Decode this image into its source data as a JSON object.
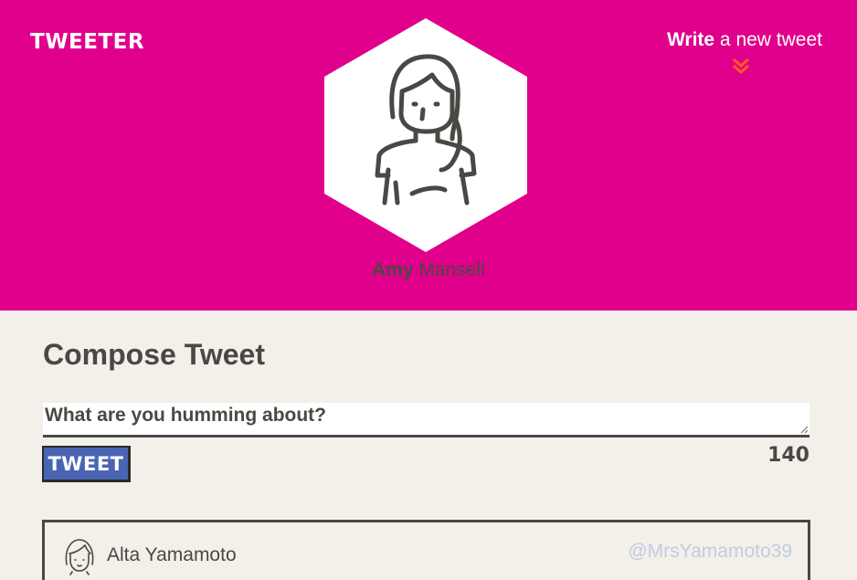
{
  "header": {
    "logo": "TWEETER",
    "write_bold": "Write",
    "write_rest": " a new tweet",
    "bg_color": "#e0008b",
    "arrow_icon": "double-chevron-down-icon",
    "arrow_color": "#ff5a1f"
  },
  "profile": {
    "first_name": "Amy",
    "last_name": "Mansell",
    "avatar_icon": "woman-avatar-icon"
  },
  "compose": {
    "title": "Compose Tweet",
    "placeholder": "What are you humming about?",
    "button_label": "TWEET",
    "char_count": "140",
    "button_color": "#4a64b4"
  },
  "tweets": [
    {
      "name": "Alta Yamamoto",
      "handle": "@MrsYamamoto39",
      "avatar_icon": "girl-avatar-icon"
    }
  ]
}
